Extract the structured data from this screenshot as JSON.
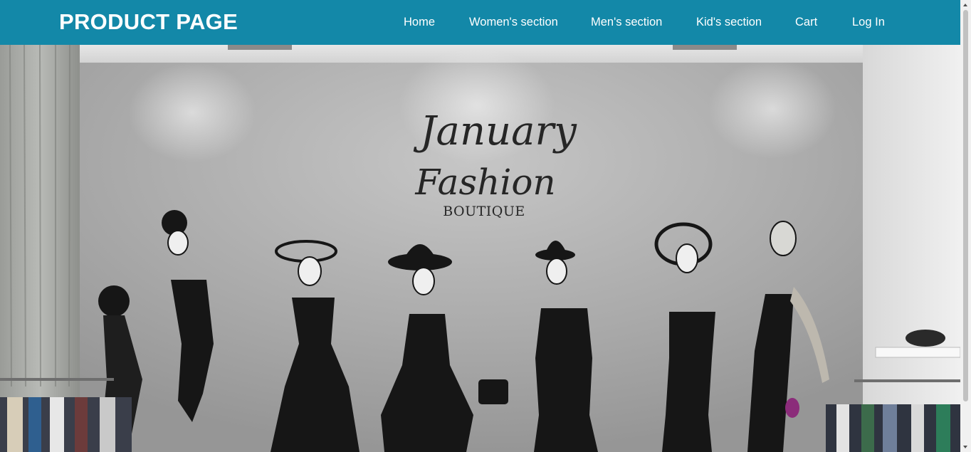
{
  "header": {
    "brand": "PRODUCT PAGE",
    "nav": [
      {
        "label": "Home"
      },
      {
        "label": "Women's section"
      },
      {
        "label": "Men's section"
      },
      {
        "label": "Kid's section"
      },
      {
        "label": "Cart"
      },
      {
        "label": "Log In"
      }
    ]
  },
  "hero": {
    "sign_script_1": "January",
    "sign_script_2": "Fashion",
    "sign_caption": "BOUTIQUE"
  },
  "colors": {
    "header_bg": "#1388a8",
    "header_text": "#ffffff"
  }
}
